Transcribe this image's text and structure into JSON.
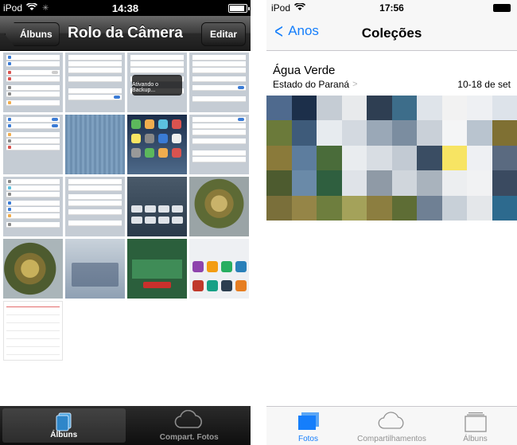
{
  "left": {
    "status": {
      "carrier": "iPod",
      "time": "14:38"
    },
    "nav": {
      "back_label": "Álbuns",
      "title": "Rolo da Câmera",
      "edit_label": "Editar"
    },
    "tabs": [
      {
        "label": "Álbuns",
        "icon": "albums-icon",
        "active": true
      },
      {
        "label": "Compart. Fotos",
        "icon": "cloud-icon",
        "active": false
      }
    ],
    "overlay_text": "Ativando o Backup..."
  },
  "right": {
    "status": {
      "carrier": "iPod",
      "time": "17:56"
    },
    "nav": {
      "back_label": "Anos",
      "title": "Coleções"
    },
    "collection": {
      "place": "Água Verde",
      "region": "Estado do Paraná",
      "dates": "10-18 de set"
    },
    "tabs": [
      {
        "label": "Fotos",
        "icon": "photos-icon",
        "active": true
      },
      {
        "label": "Compartilhamentos",
        "icon": "cloud-icon",
        "active": false
      },
      {
        "label": "Álbuns",
        "icon": "albums-icon",
        "active": false
      }
    ]
  },
  "colors": {
    "ios7_blue": "#157efb",
    "ios6_bar": "#1c1c1c"
  }
}
